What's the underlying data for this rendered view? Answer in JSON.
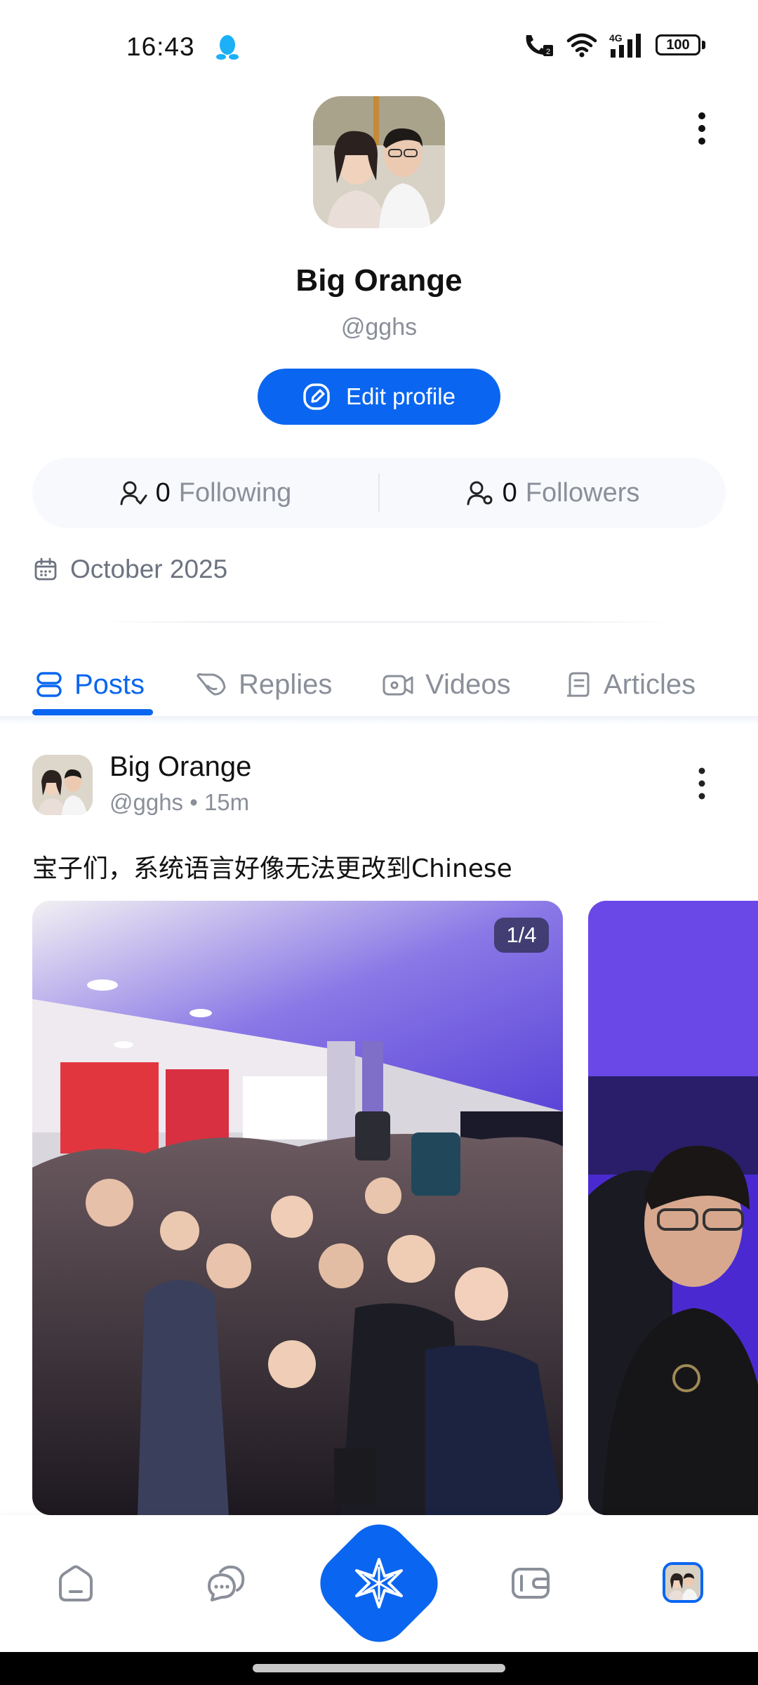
{
  "status_bar": {
    "time": "16:43",
    "icons": [
      "qq-icon",
      "call-hd-icon",
      "wifi-icon",
      "4g-signal-icon"
    ],
    "battery": "100"
  },
  "profile": {
    "name": "Big Orange",
    "handle": "@gghs",
    "edit_label": "Edit profile",
    "following_count": "0",
    "following_label": "Following",
    "followers_count": "0",
    "followers_label": "Followers",
    "joined": "October 2025"
  },
  "tabs": [
    {
      "label": "Posts",
      "active": true
    },
    {
      "label": "Replies",
      "active": false
    },
    {
      "label": "Videos",
      "active": false
    },
    {
      "label": "Articles",
      "active": false
    }
  ],
  "post": {
    "author": "Big Orange",
    "meta": "@gghs • 15m",
    "text": "宝子们，系统语言好像无法更改到Chinese",
    "image_counter": "1/4"
  },
  "bottom_nav": [
    "home-icon",
    "messages-icon",
    "compose-star-icon",
    "wallet-icon",
    "profile-avatar"
  ],
  "colors": {
    "accent": "#0a66f0",
    "muted": "#8a8f99"
  }
}
